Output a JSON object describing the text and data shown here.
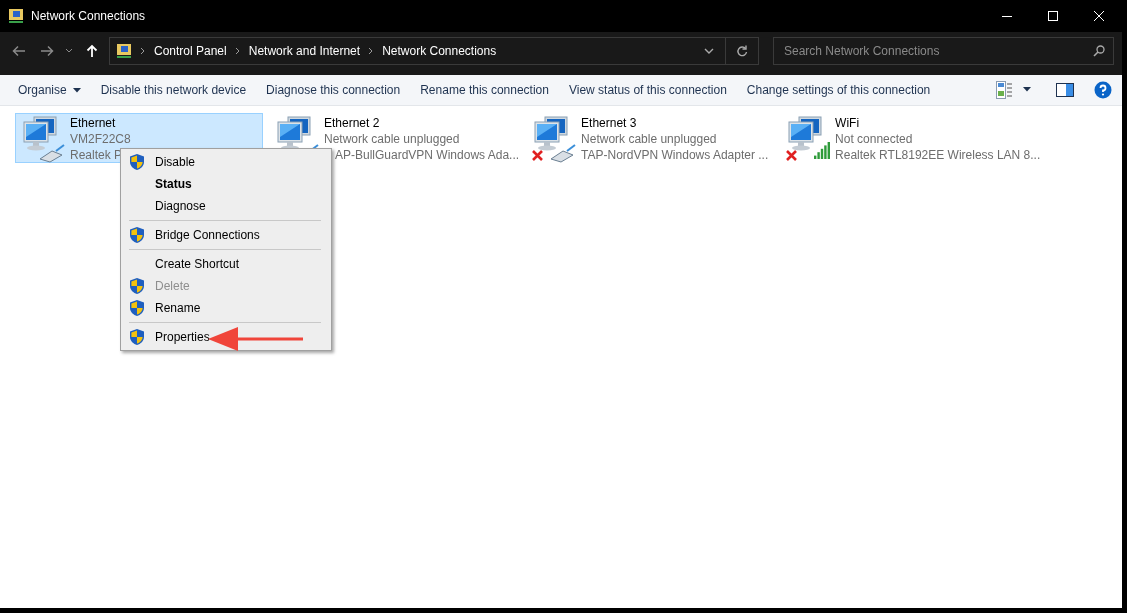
{
  "window": {
    "title": "Network Connections"
  },
  "breadcrumb": [
    "Control Panel",
    "Network and Internet",
    "Network Connections"
  ],
  "search": {
    "placeholder": "Search Network Connections"
  },
  "toolbar": {
    "organise": "Organise",
    "commands": [
      "Disable this network device",
      "Diagnose this connection",
      "Rename this connection",
      "View status of this connection",
      "Change settings of this connection"
    ]
  },
  "connections": [
    {
      "name": "Ethernet",
      "status": "VM2F22C8",
      "adapter": "Realtek P",
      "kind": "cable",
      "disconnected": false,
      "selected": true
    },
    {
      "name": "Ethernet 2",
      "status": "Network cable unplugged",
      "adapter": "AP-BullGuardVPN Windows Ada...",
      "kind": "cable",
      "disconnected": false,
      "selected": false
    },
    {
      "name": "Ethernet 3",
      "status": "Network cable unplugged",
      "adapter": "TAP-NordVPN Windows Adapter ...",
      "kind": "cable",
      "disconnected": true,
      "selected": false
    },
    {
      "name": "WiFi",
      "status": "Not connected",
      "adapter": "Realtek RTL8192EE Wireless LAN 8...",
      "kind": "wireless",
      "disconnected": true,
      "selected": false
    }
  ],
  "context_menu": [
    {
      "kind": "item",
      "label": "Disable",
      "shield": true,
      "default": false,
      "disabled": false
    },
    {
      "kind": "item",
      "label": "Status",
      "shield": false,
      "default": true,
      "disabled": false
    },
    {
      "kind": "item",
      "label": "Diagnose",
      "shield": false,
      "default": false,
      "disabled": false
    },
    {
      "kind": "separator"
    },
    {
      "kind": "item",
      "label": "Bridge Connections",
      "shield": true,
      "default": false,
      "disabled": false
    },
    {
      "kind": "separator"
    },
    {
      "kind": "item",
      "label": "Create Shortcut",
      "shield": false,
      "default": false,
      "disabled": false
    },
    {
      "kind": "item",
      "label": "Delete",
      "shield": true,
      "default": false,
      "disabled": true
    },
    {
      "kind": "item",
      "label": "Rename",
      "shield": true,
      "default": false,
      "disabled": false
    },
    {
      "kind": "separator"
    },
    {
      "kind": "item",
      "label": "Properties",
      "shield": true,
      "default": false,
      "disabled": false
    }
  ]
}
